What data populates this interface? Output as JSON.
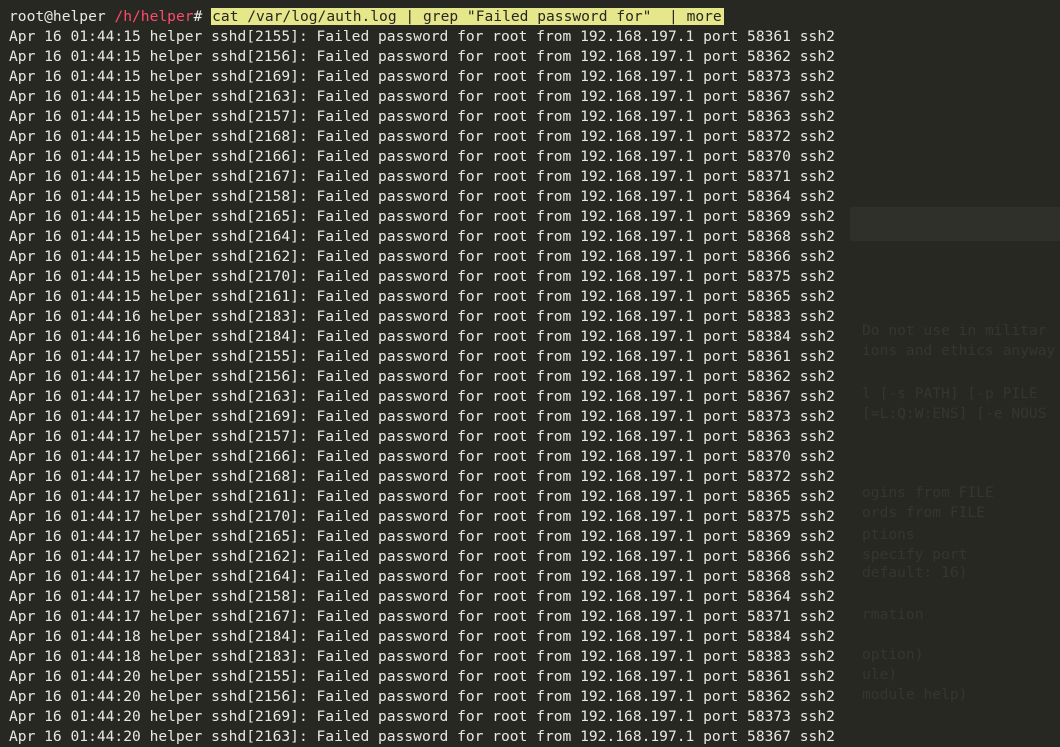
{
  "terminal": {
    "prompt": {
      "user_host": "root@helper",
      "path": "/h/helper",
      "symbol": "#",
      "command": "cat /var/log/auth.log | grep \"Failed password for\"  | more"
    },
    "lines": [
      "Apr 16 01:44:15 helper sshd[2155]: Failed password for root from 192.168.197.1 port 58361 ssh2",
      "Apr 16 01:44:15 helper sshd[2156]: Failed password for root from 192.168.197.1 port 58362 ssh2",
      "Apr 16 01:44:15 helper sshd[2169]: Failed password for root from 192.168.197.1 port 58373 ssh2",
      "Apr 16 01:44:15 helper sshd[2163]: Failed password for root from 192.168.197.1 port 58367 ssh2",
      "Apr 16 01:44:15 helper sshd[2157]: Failed password for root from 192.168.197.1 port 58363 ssh2",
      "Apr 16 01:44:15 helper sshd[2168]: Failed password for root from 192.168.197.1 port 58372 ssh2",
      "Apr 16 01:44:15 helper sshd[2166]: Failed password for root from 192.168.197.1 port 58370 ssh2",
      "Apr 16 01:44:15 helper sshd[2167]: Failed password for root from 192.168.197.1 port 58371 ssh2",
      "Apr 16 01:44:15 helper sshd[2158]: Failed password for root from 192.168.197.1 port 58364 ssh2",
      "Apr 16 01:44:15 helper sshd[2165]: Failed password for root from 192.168.197.1 port 58369 ssh2",
      "Apr 16 01:44:15 helper sshd[2164]: Failed password for root from 192.168.197.1 port 58368 ssh2",
      "Apr 16 01:44:15 helper sshd[2162]: Failed password for root from 192.168.197.1 port 58366 ssh2",
      "Apr 16 01:44:15 helper sshd[2170]: Failed password for root from 192.168.197.1 port 58375 ssh2",
      "Apr 16 01:44:15 helper sshd[2161]: Failed password for root from 192.168.197.1 port 58365 ssh2",
      "Apr 16 01:44:16 helper sshd[2183]: Failed password for root from 192.168.197.1 port 58383 ssh2",
      "Apr 16 01:44:16 helper sshd[2184]: Failed password for root from 192.168.197.1 port 58384 ssh2",
      "Apr 16 01:44:17 helper sshd[2155]: Failed password for root from 192.168.197.1 port 58361 ssh2",
      "Apr 16 01:44:17 helper sshd[2156]: Failed password for root from 192.168.197.1 port 58362 ssh2",
      "Apr 16 01:44:17 helper sshd[2163]: Failed password for root from 192.168.197.1 port 58367 ssh2",
      "Apr 16 01:44:17 helper sshd[2169]: Failed password for root from 192.168.197.1 port 58373 ssh2",
      "Apr 16 01:44:17 helper sshd[2157]: Failed password for root from 192.168.197.1 port 58363 ssh2",
      "Apr 16 01:44:17 helper sshd[2166]: Failed password for root from 192.168.197.1 port 58370 ssh2",
      "Apr 16 01:44:17 helper sshd[2168]: Failed password for root from 192.168.197.1 port 58372 ssh2",
      "Apr 16 01:44:17 helper sshd[2161]: Failed password for root from 192.168.197.1 port 58365 ssh2",
      "Apr 16 01:44:17 helper sshd[2170]: Failed password for root from 192.168.197.1 port 58375 ssh2",
      "Apr 16 01:44:17 helper sshd[2165]: Failed password for root from 192.168.197.1 port 58369 ssh2",
      "Apr 16 01:44:17 helper sshd[2162]: Failed password for root from 192.168.197.1 port 58366 ssh2",
      "Apr 16 01:44:17 helper sshd[2164]: Failed password for root from 192.168.197.1 port 58368 ssh2",
      "Apr 16 01:44:17 helper sshd[2158]: Failed password for root from 192.168.197.1 port 58364 ssh2",
      "Apr 16 01:44:17 helper sshd[2167]: Failed password for root from 192.168.197.1 port 58371 ssh2",
      "Apr 16 01:44:18 helper sshd[2184]: Failed password for root from 192.168.197.1 port 58384 ssh2",
      "Apr 16 01:44:18 helper sshd[2183]: Failed password for root from 192.168.197.1 port 58383 ssh2",
      "Apr 16 01:44:20 helper sshd[2155]: Failed password for root from 192.168.197.1 port 58361 ssh2",
      "Apr 16 01:44:20 helper sshd[2156]: Failed password for root from 192.168.197.1 port 58362 ssh2",
      "Apr 16 01:44:20 helper sshd[2169]: Failed password for root from 192.168.197.1 port 58373 ssh2",
      "Apr 16 01:44:20 helper sshd[2163]: Failed password for root from 192.168.197.1 port 58367 ssh2"
    ],
    "background_ghost_text": [
      "Do not use in militar",
      "ions and ethics anyway",
      "l [-s PATH] [-p PILE",
      "[=L:Q:W:ENS] [-e NOUS",
      "ogins from FILE",
      "ords from FILE",
      "ptions",
      "specify port",
      "default: 16)",
      "rmation",
      "option)",
      "ule)",
      "module help)"
    ],
    "colors": {
      "background": "#272822",
      "foreground": "#e9e9e2",
      "path": "#ff4a6b",
      "command_highlight": "#e6e68a",
      "ghost_text": "#35362f"
    }
  }
}
